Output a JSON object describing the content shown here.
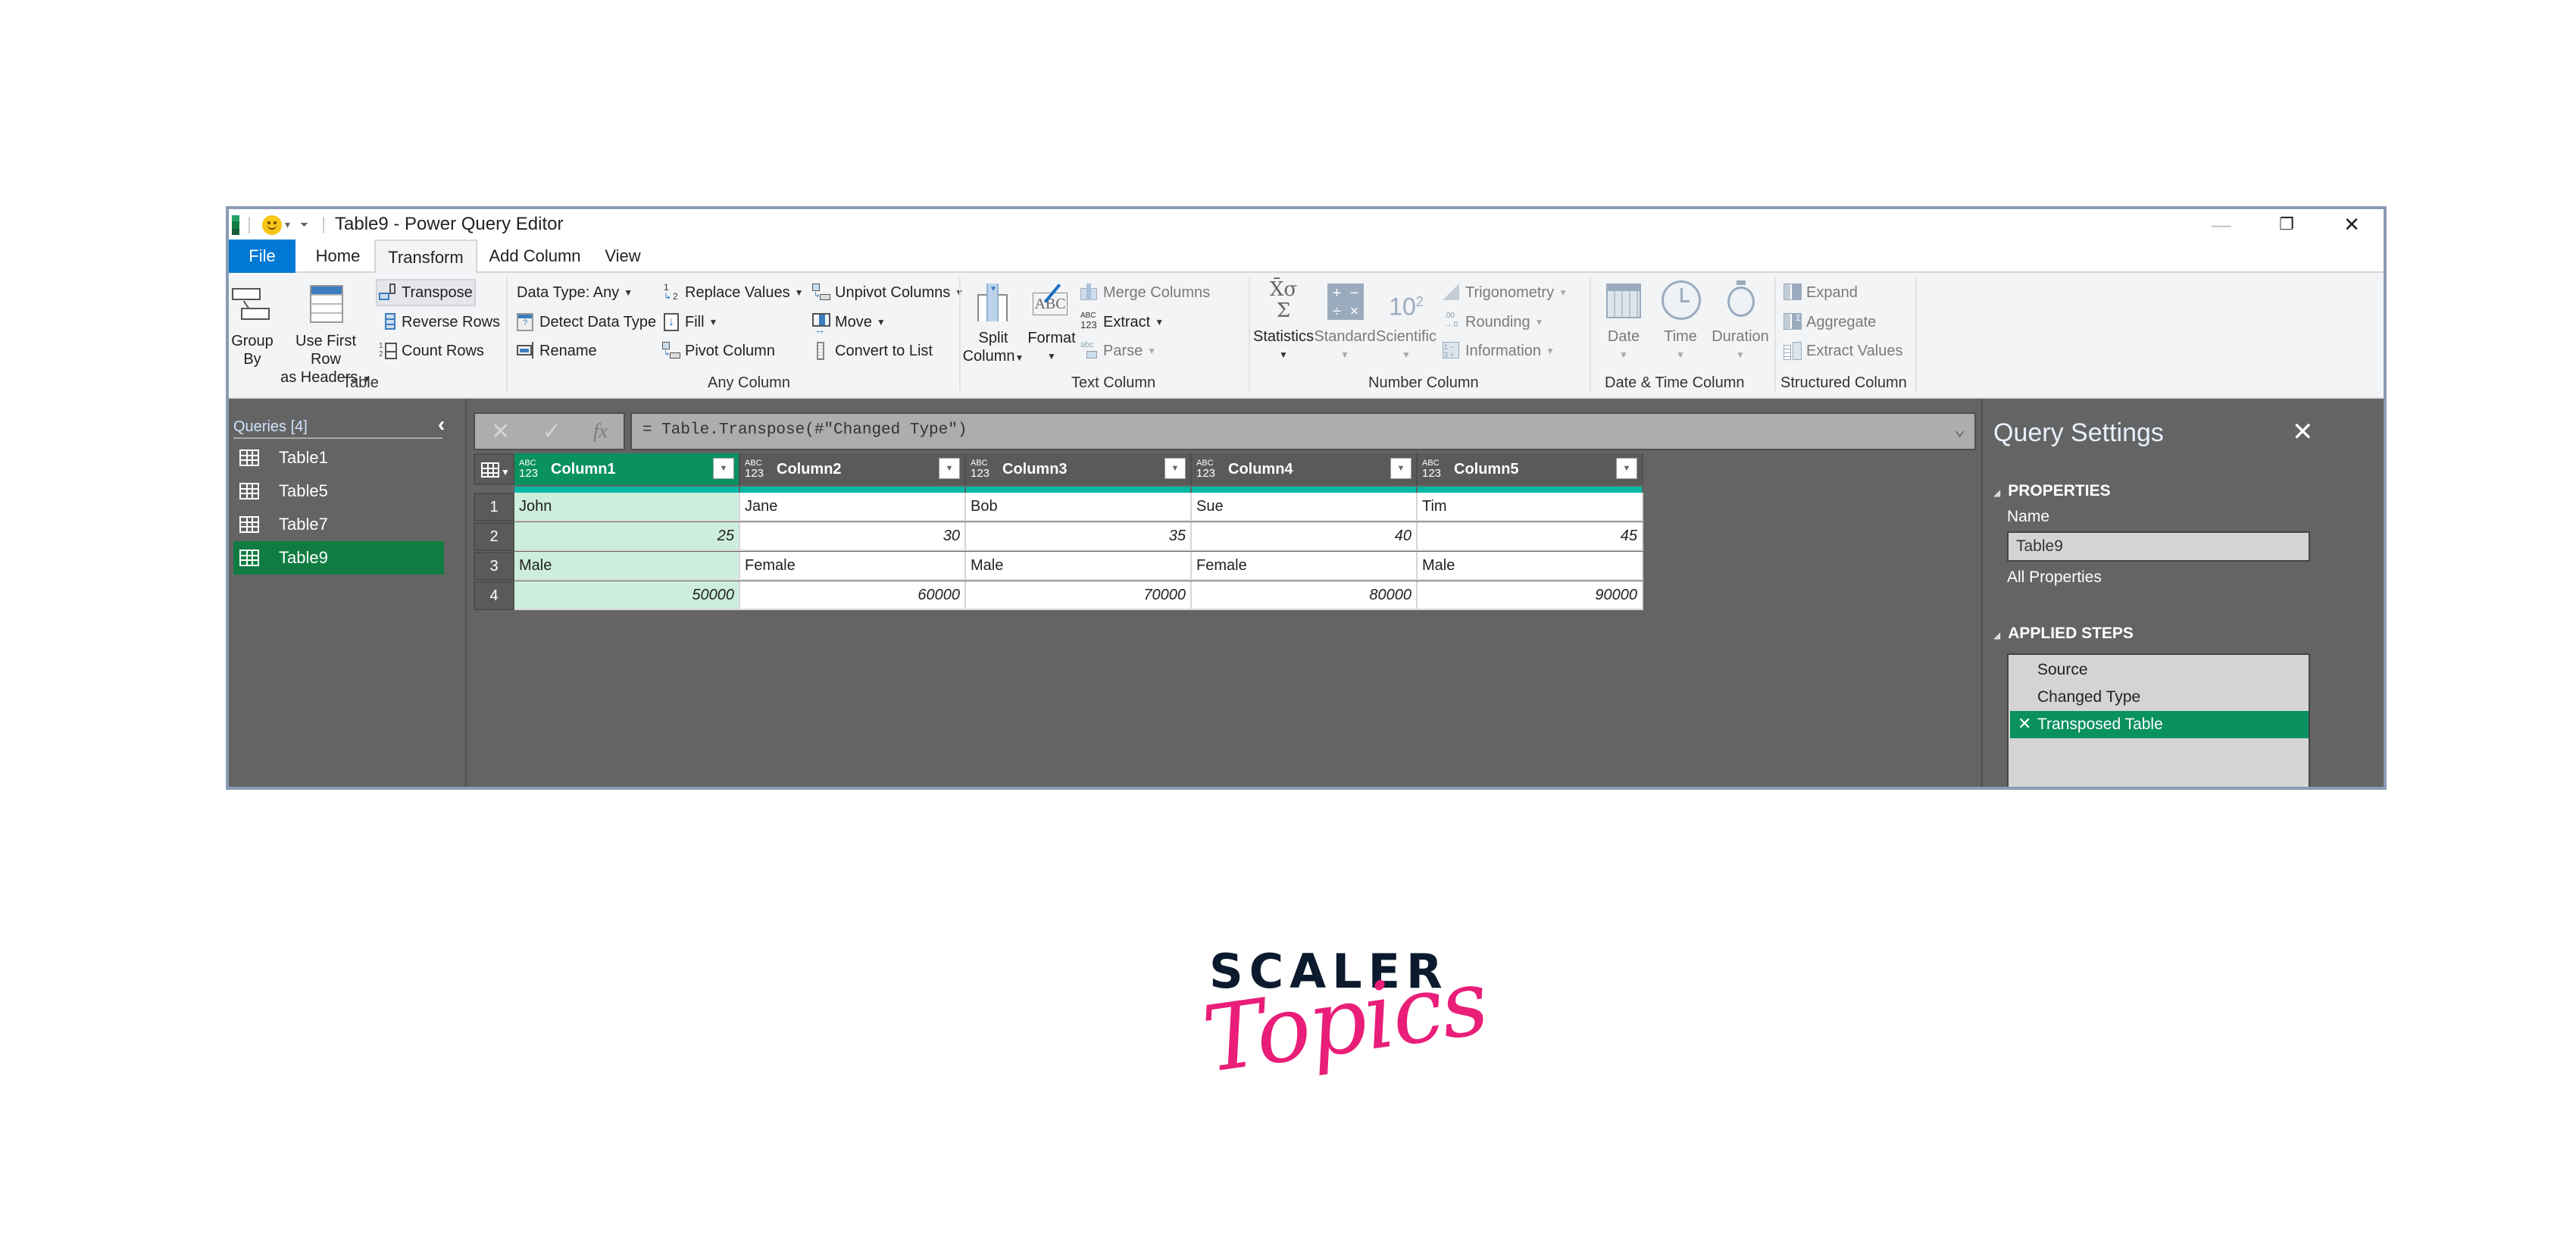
{
  "window": {
    "title": "Table9 - Power Query Editor",
    "controls": {
      "minimize": "—",
      "restore": "❐",
      "close": "✕"
    }
  },
  "tabs": [
    {
      "label": "File"
    },
    {
      "label": "Home"
    },
    {
      "label": "Transform",
      "active": true
    },
    {
      "label": "Add Column"
    },
    {
      "label": "View"
    }
  ],
  "ribbon": {
    "table_group": {
      "label": "Table",
      "group_by": [
        "Group",
        "By"
      ],
      "first_row_headers": [
        "Use First Row",
        "as Headers"
      ],
      "transpose": "Transpose",
      "reverse_rows": "Reverse Rows",
      "count_rows": "Count Rows"
    },
    "any_column_group": {
      "label": "Any Column",
      "data_type": "Data Type: Any",
      "detect_data_type": "Detect Data Type",
      "rename": "Rename",
      "replace_values": "Replace Values",
      "fill": "Fill",
      "pivot_column": "Pivot Column",
      "unpivot_columns": "Unpivot Columns",
      "move": "Move",
      "convert_to_list": "Convert to List"
    },
    "text_column_group": {
      "label": "Text Column",
      "split_column": [
        "Split",
        "Column"
      ],
      "format": "Format",
      "merge_columns": "Merge Columns",
      "extract": "Extract",
      "parse": "Parse"
    },
    "number_column_group": {
      "label": "Number Column",
      "statistics": "Statistics",
      "standard": "Standard",
      "scientific": "Scientific",
      "trigonometry": "Trigonometry",
      "rounding": "Rounding",
      "information": "Information"
    },
    "datetime_group": {
      "label": "Date & Time Column",
      "date": "Date",
      "time": "Time",
      "duration": "Duration"
    },
    "structured_group": {
      "label": "Structured Column",
      "expand": "Expand",
      "aggregate": "Aggregate",
      "extract_values": "Extract Values"
    }
  },
  "queries": {
    "title": "Queries [4]",
    "items": [
      {
        "label": "Table1"
      },
      {
        "label": "Table5"
      },
      {
        "label": "Table7"
      },
      {
        "label": "Table9",
        "selected": true
      }
    ]
  },
  "formula_bar": {
    "cancel": "✕",
    "commit": "✓",
    "fx": "fx",
    "formula": "= Table.Transpose(#\"Changed Type\")"
  },
  "grid": {
    "type_label_top": "ABC",
    "type_label_bottom": "123",
    "columns": [
      "Column1",
      "Column2",
      "Column3",
      "Column4",
      "Column5"
    ],
    "selected_column": 0,
    "rows": [
      {
        "num": "1",
        "cells": [
          "John",
          "Jane",
          "Bob",
          "Sue",
          "Tim"
        ],
        "numeric": false
      },
      {
        "num": "2",
        "cells": [
          "25",
          "30",
          "35",
          "40",
          "45"
        ],
        "numeric": true
      },
      {
        "num": "3",
        "cells": [
          "Male",
          "Female",
          "Male",
          "Female",
          "Male"
        ],
        "numeric": false
      },
      {
        "num": "4",
        "cells": [
          "50000",
          "60000",
          "70000",
          "80000",
          "90000"
        ],
        "numeric": true
      }
    ]
  },
  "query_settings": {
    "title": "Query Settings",
    "properties_header": "PROPERTIES",
    "name_label": "Name",
    "name_value": "Table9",
    "all_properties": "All Properties",
    "applied_steps_header": "APPLIED STEPS",
    "steps": [
      {
        "label": "Source"
      },
      {
        "label": "Changed Type"
      },
      {
        "label": "Transposed Table",
        "selected": true
      }
    ]
  },
  "logo": {
    "line1": "SCALER",
    "line2": "Topics"
  },
  "colors": {
    "accent_green": "#107c41",
    "selected_col": "#0a9160",
    "file_tab": "#0078d4",
    "quality_bar": "#00b8a4",
    "logo_pink": "#e91e78"
  }
}
